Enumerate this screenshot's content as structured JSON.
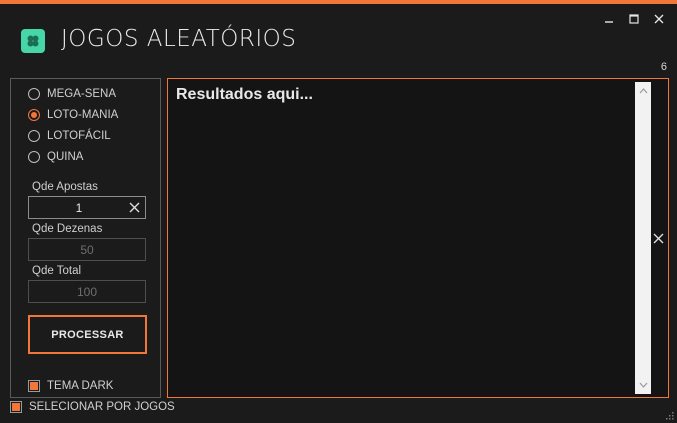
{
  "window": {
    "title": "JOGOS ALEATÓRIOS",
    "accent_color": "#f0763a",
    "logo_icon": "clover-icon",
    "controls": {
      "minimize": "—",
      "maximize": "☐",
      "close": "✕"
    }
  },
  "counter": "6",
  "games": {
    "options": [
      {
        "label": "MEGA-SENA",
        "selected": false
      },
      {
        "label": "LOTO-MANIA",
        "selected": true
      },
      {
        "label": "LOTOFÁCIL",
        "selected": false
      },
      {
        "label": "QUINA",
        "selected": false
      }
    ]
  },
  "fields": {
    "apostas": {
      "label": "Qde Apostas",
      "value": "1"
    },
    "dezenas": {
      "label": "Qde Dezenas",
      "value": "50"
    },
    "total": {
      "label": "Qde Total",
      "value": "100"
    }
  },
  "process_button": "PROCESSAR",
  "options": {
    "tema_dark": {
      "label": "TEMA DARK",
      "checked": true
    },
    "selecionar_por_jogos": {
      "label": "SELECIONAR POR JOGOS",
      "checked": true
    }
  },
  "results": {
    "placeholder": "Resultados aqui..."
  }
}
